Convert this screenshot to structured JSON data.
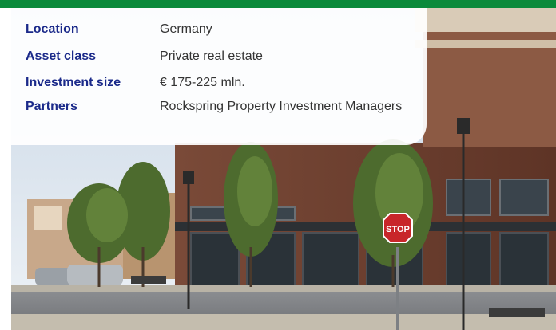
{
  "colors": {
    "accent_bar": "#0b8a3b",
    "label_text": "#1b2a8a"
  },
  "details": [
    {
      "label": "Location",
      "value": "Germany"
    },
    {
      "label": "Asset class",
      "value": "Private real estate"
    },
    {
      "label": "Investment size",
      "value": "€ 175-225 mln."
    },
    {
      "label": "Partners",
      "value": "Rockspring Property Investment Managers"
    }
  ],
  "photo": {
    "sign_text": "STOP"
  }
}
